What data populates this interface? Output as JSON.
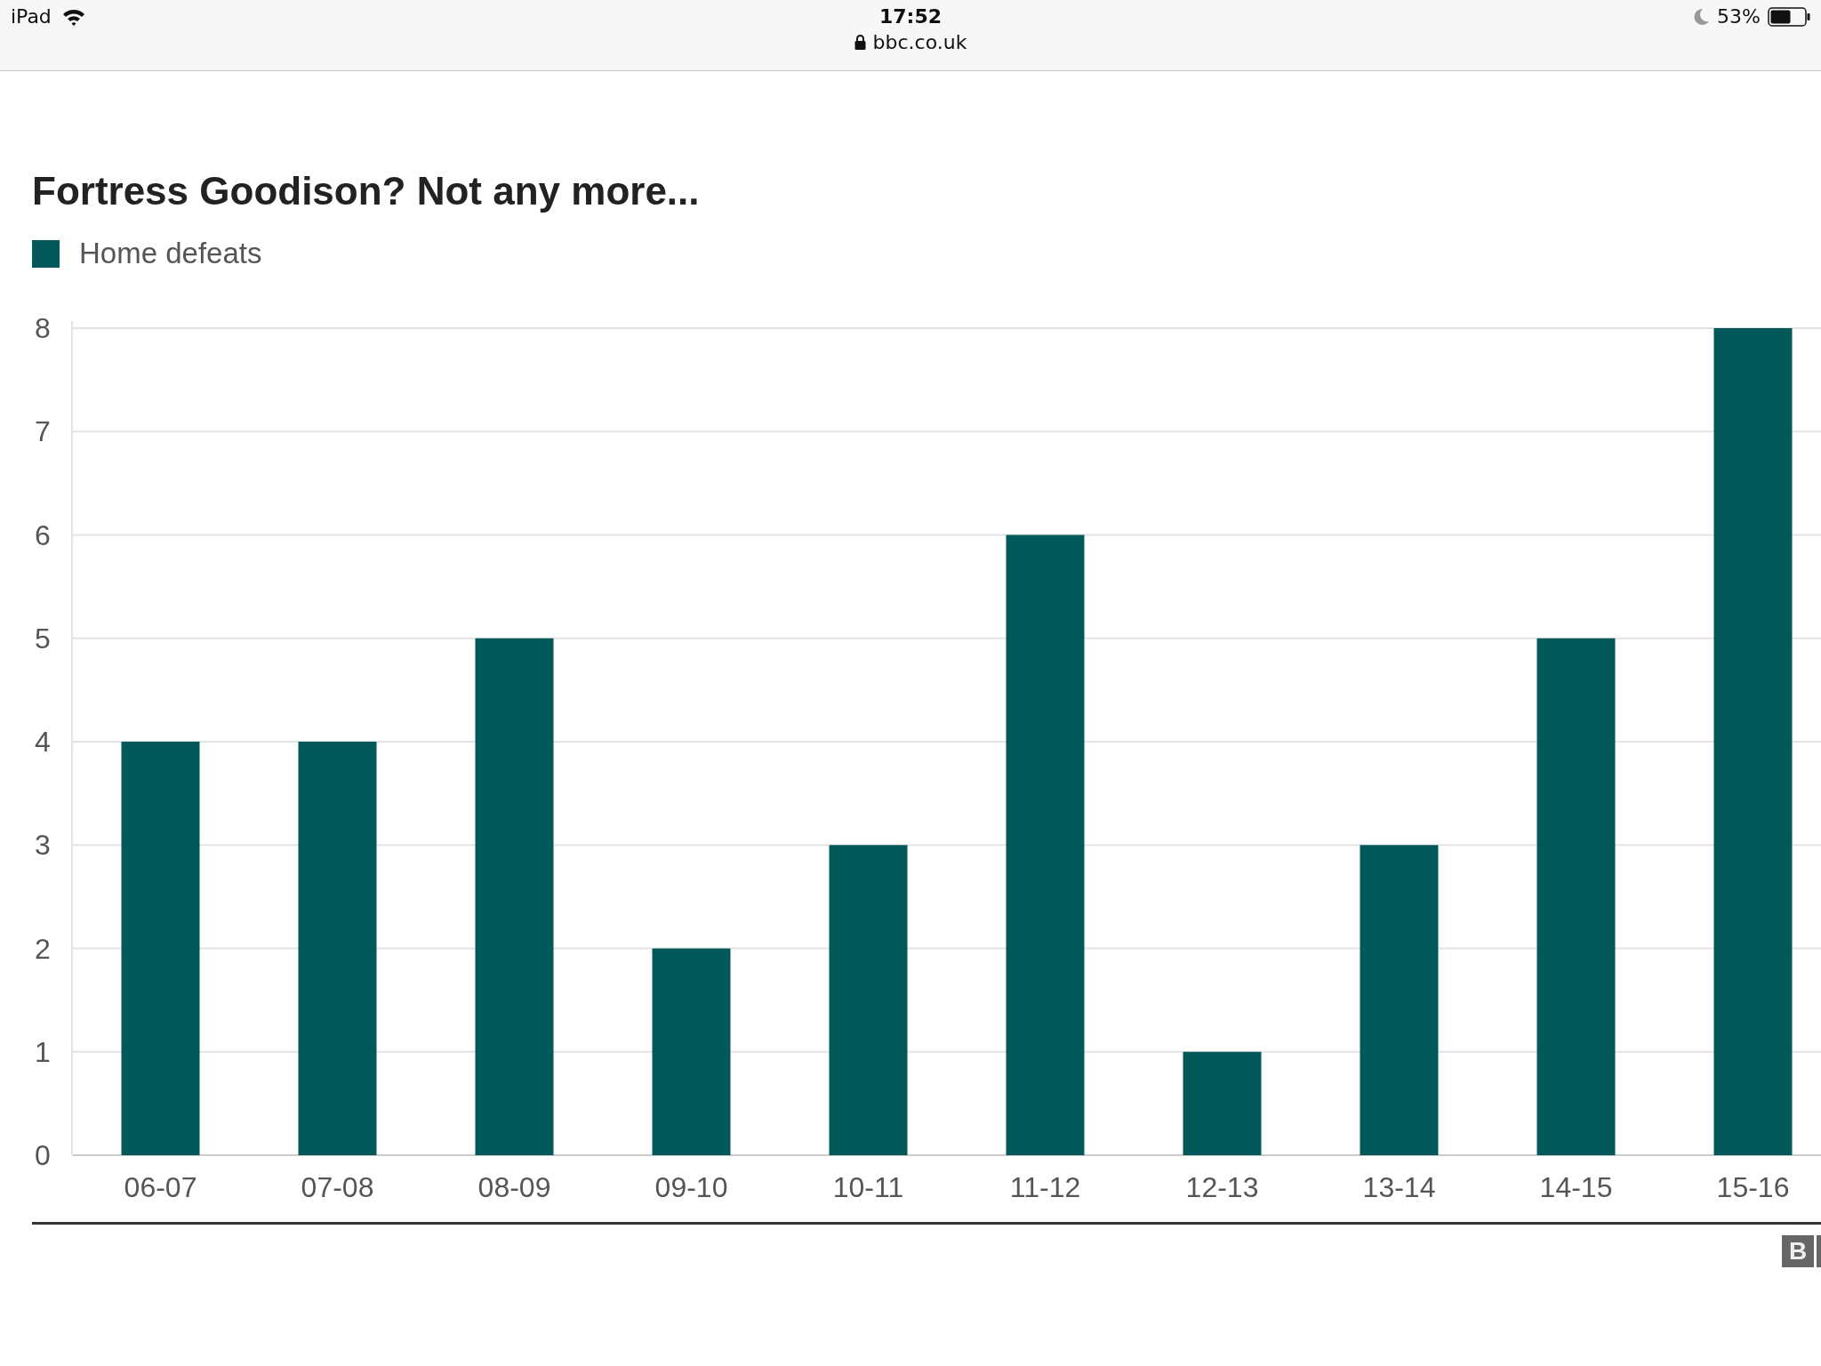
{
  "status_bar": {
    "device": "iPad",
    "time": "17:52",
    "url": "bbc.co.uk",
    "battery": "53%"
  },
  "article": {
    "chart_data": {
      "type": "bar",
      "title": "Fortress Goodison? Not any more...",
      "categories": [
        "06-07",
        "07-08",
        "08-09",
        "09-10",
        "10-11",
        "11-12",
        "12-13",
        "13-14",
        "14-15",
        "15-16"
      ],
      "series": [
        {
          "name": "Home defeats",
          "color": "#03585a",
          "values": [
            4,
            4,
            5,
            2,
            3,
            6,
            1,
            3,
            5,
            8
          ]
        }
      ],
      "ylim": [
        0,
        8
      ],
      "grid": true,
      "yticks": [
        0,
        1,
        2,
        3,
        4,
        5,
        6,
        7,
        8
      ]
    },
    "logo": "B"
  }
}
